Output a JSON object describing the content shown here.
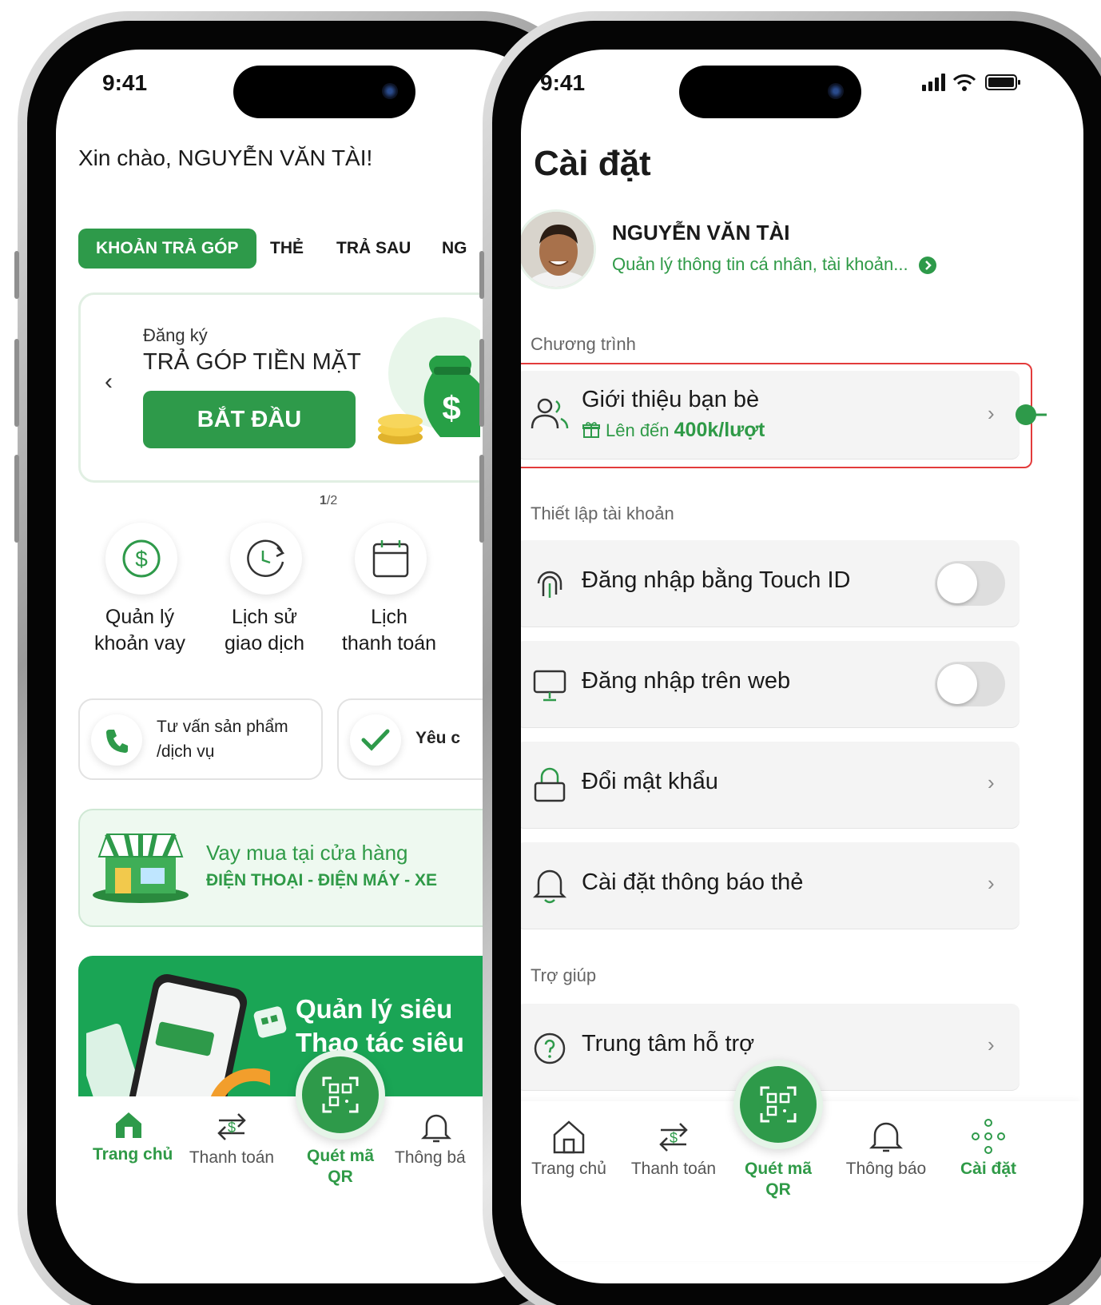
{
  "status_bar": {
    "time_left": "9:41",
    "time_right": "9:41"
  },
  "home": {
    "greeting": "Xin chào, NGUYỄN VĂN TÀI!",
    "tabs": [
      {
        "label": "KHOẢN TRẢ GÓP",
        "active": true
      },
      {
        "label": "THẺ"
      },
      {
        "label": "TRẢ SAU"
      },
      {
        "label": "NG"
      }
    ],
    "banner": {
      "subtitle": "Đăng ký",
      "title": "TRẢ GÓP TIỀN MẶT",
      "button": "BẮT ĐẦU",
      "page_current": "1",
      "page_total": "/2"
    },
    "quick_actions": [
      {
        "line1": "Quản lý",
        "line2": "khoản vay",
        "icon": "dollar-circle-icon"
      },
      {
        "line1": "Lịch sử",
        "line2": "giao dịch",
        "icon": "history-clock-icon"
      },
      {
        "line1": "Lịch",
        "line2": "thanh toán",
        "icon": "calendar-icon"
      }
    ],
    "support_cards": [
      {
        "line1": "Tư vấn sản phẩm",
        "line2": "/dịch vụ",
        "icon": "phone-icon"
      },
      {
        "line1": "Yêu c",
        "icon": "check-icon"
      }
    ],
    "store_card": {
      "title": "Vay mua tại cửa hàng",
      "subtitle": "ĐIỆN THOẠI - ĐIỆN MÁY - XE"
    },
    "promo": {
      "line1": "Quản lý siêu",
      "line2": "Thao tác siêu"
    },
    "nav": [
      {
        "label": "Trang chủ",
        "active": true
      },
      {
        "label": "Thanh toán"
      },
      {
        "label_1": "Quét mã",
        "label_2": "QR"
      },
      {
        "label": "Thông bá"
      }
    ]
  },
  "settings": {
    "title": "Cài đặt",
    "profile": {
      "name": "NGUYỄN VĂN TÀI",
      "link": "Quản lý thông tin cá nhân, tài khoản..."
    },
    "sections": {
      "program": "Chương trình",
      "account": "Thiết lập tài khoản",
      "help": "Trợ giúp"
    },
    "referral": {
      "title": "Giới thiệu bạn bè",
      "reward_prefix": "Lên đến",
      "reward_value": "400k/lượt"
    },
    "rows": [
      {
        "label": "Đăng nhập bằng Touch ID",
        "icon": "fingerprint-icon",
        "control": "toggle",
        "on": false
      },
      {
        "label": "Đăng nhập trên web",
        "icon": "monitor-icon",
        "control": "toggle",
        "on": false
      },
      {
        "label": "Đổi mật khẩu",
        "icon": "lock-icon",
        "control": "chevron"
      },
      {
        "label": "Cài đặt thông báo thẻ",
        "icon": "bell-icon",
        "control": "chevron"
      }
    ],
    "help_row": {
      "label": "Trung tâm hỗ trợ",
      "icon": "question-circle-icon"
    },
    "nav": [
      {
        "label": "Trang chủ"
      },
      {
        "label": "Thanh toán"
      },
      {
        "label_1": "Quét mã",
        "label_2": "QR"
      },
      {
        "label": "Thông báo"
      },
      {
        "label": "Cài đặt",
        "active": true
      }
    ]
  },
  "colors": {
    "brand_green": "#2e9a4a",
    "highlight_red": "#e33b3b",
    "row_bg": "#f4f4f4"
  }
}
